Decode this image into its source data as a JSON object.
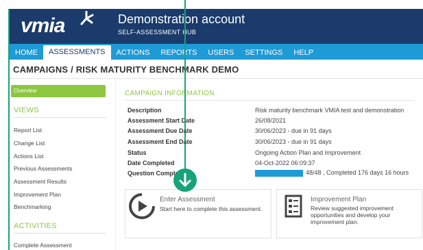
{
  "header": {
    "logo_text": "vmia",
    "account_title": "Demonstration account",
    "account_subtitle": "SELF-ASSESSMENT HUB"
  },
  "nav": {
    "items": [
      {
        "label": "HOME",
        "active": false
      },
      {
        "label": "ASSESSMENTS",
        "active": true
      },
      {
        "label": "ACTIONS",
        "active": false
      },
      {
        "label": "REPORTS",
        "active": false
      },
      {
        "label": "USERS",
        "active": false
      },
      {
        "label": "SETTINGS",
        "active": false
      },
      {
        "label": "HELP",
        "active": false
      }
    ]
  },
  "breadcrumb": "CAMPAIGNS / RISK MATURITY BENCHMARK DEMO",
  "sidebar": {
    "overview_label": "Overview",
    "views_heading": "VIEWS",
    "views": [
      "Report List",
      "Change List",
      "Actions List",
      "Previous Assessments",
      "Assessment Results",
      "Improvement Plan",
      "Benchmarking"
    ],
    "activities_heading": "ACTIVITIES",
    "activities": [
      "Complete Assessment"
    ]
  },
  "campaign": {
    "heading": "CAMPAIGN INFORMATION",
    "rows": [
      {
        "label": "Description",
        "value": "Risk maturity benchmark VMIA test and demonstration"
      },
      {
        "label": "Assessment Start Date",
        "value": "26/08/2021"
      },
      {
        "label": "Assessment Due Date",
        "value": "30/06/2023 - due in 91 days"
      },
      {
        "label": "Assessment End Date",
        "value": "30/06/2023 - due in 91 days"
      },
      {
        "label": "Status",
        "value": "Ongoing Action Plan and Improvement"
      },
      {
        "label": "Date Completed",
        "value": "04-Oct-2022 06:09:37"
      },
      {
        "label": "Question Completion",
        "value": ""
      }
    ],
    "progress_fraction": 1.0,
    "progress_text": "48/48 , Completed 176 days 16 hours"
  },
  "cards": {
    "enter": {
      "title": "Enter Assessment",
      "description": "Start here to complete this assessment."
    },
    "improve": {
      "title": "Improvement Plan",
      "description": "Review suggested improvement opportunities and develop your improvement plan."
    }
  },
  "colors": {
    "header_bg": "#1a3b6b",
    "nav_bg": "#1e9ad6",
    "accent_green": "#8dc63f",
    "annotation_green": "#17a37a"
  }
}
